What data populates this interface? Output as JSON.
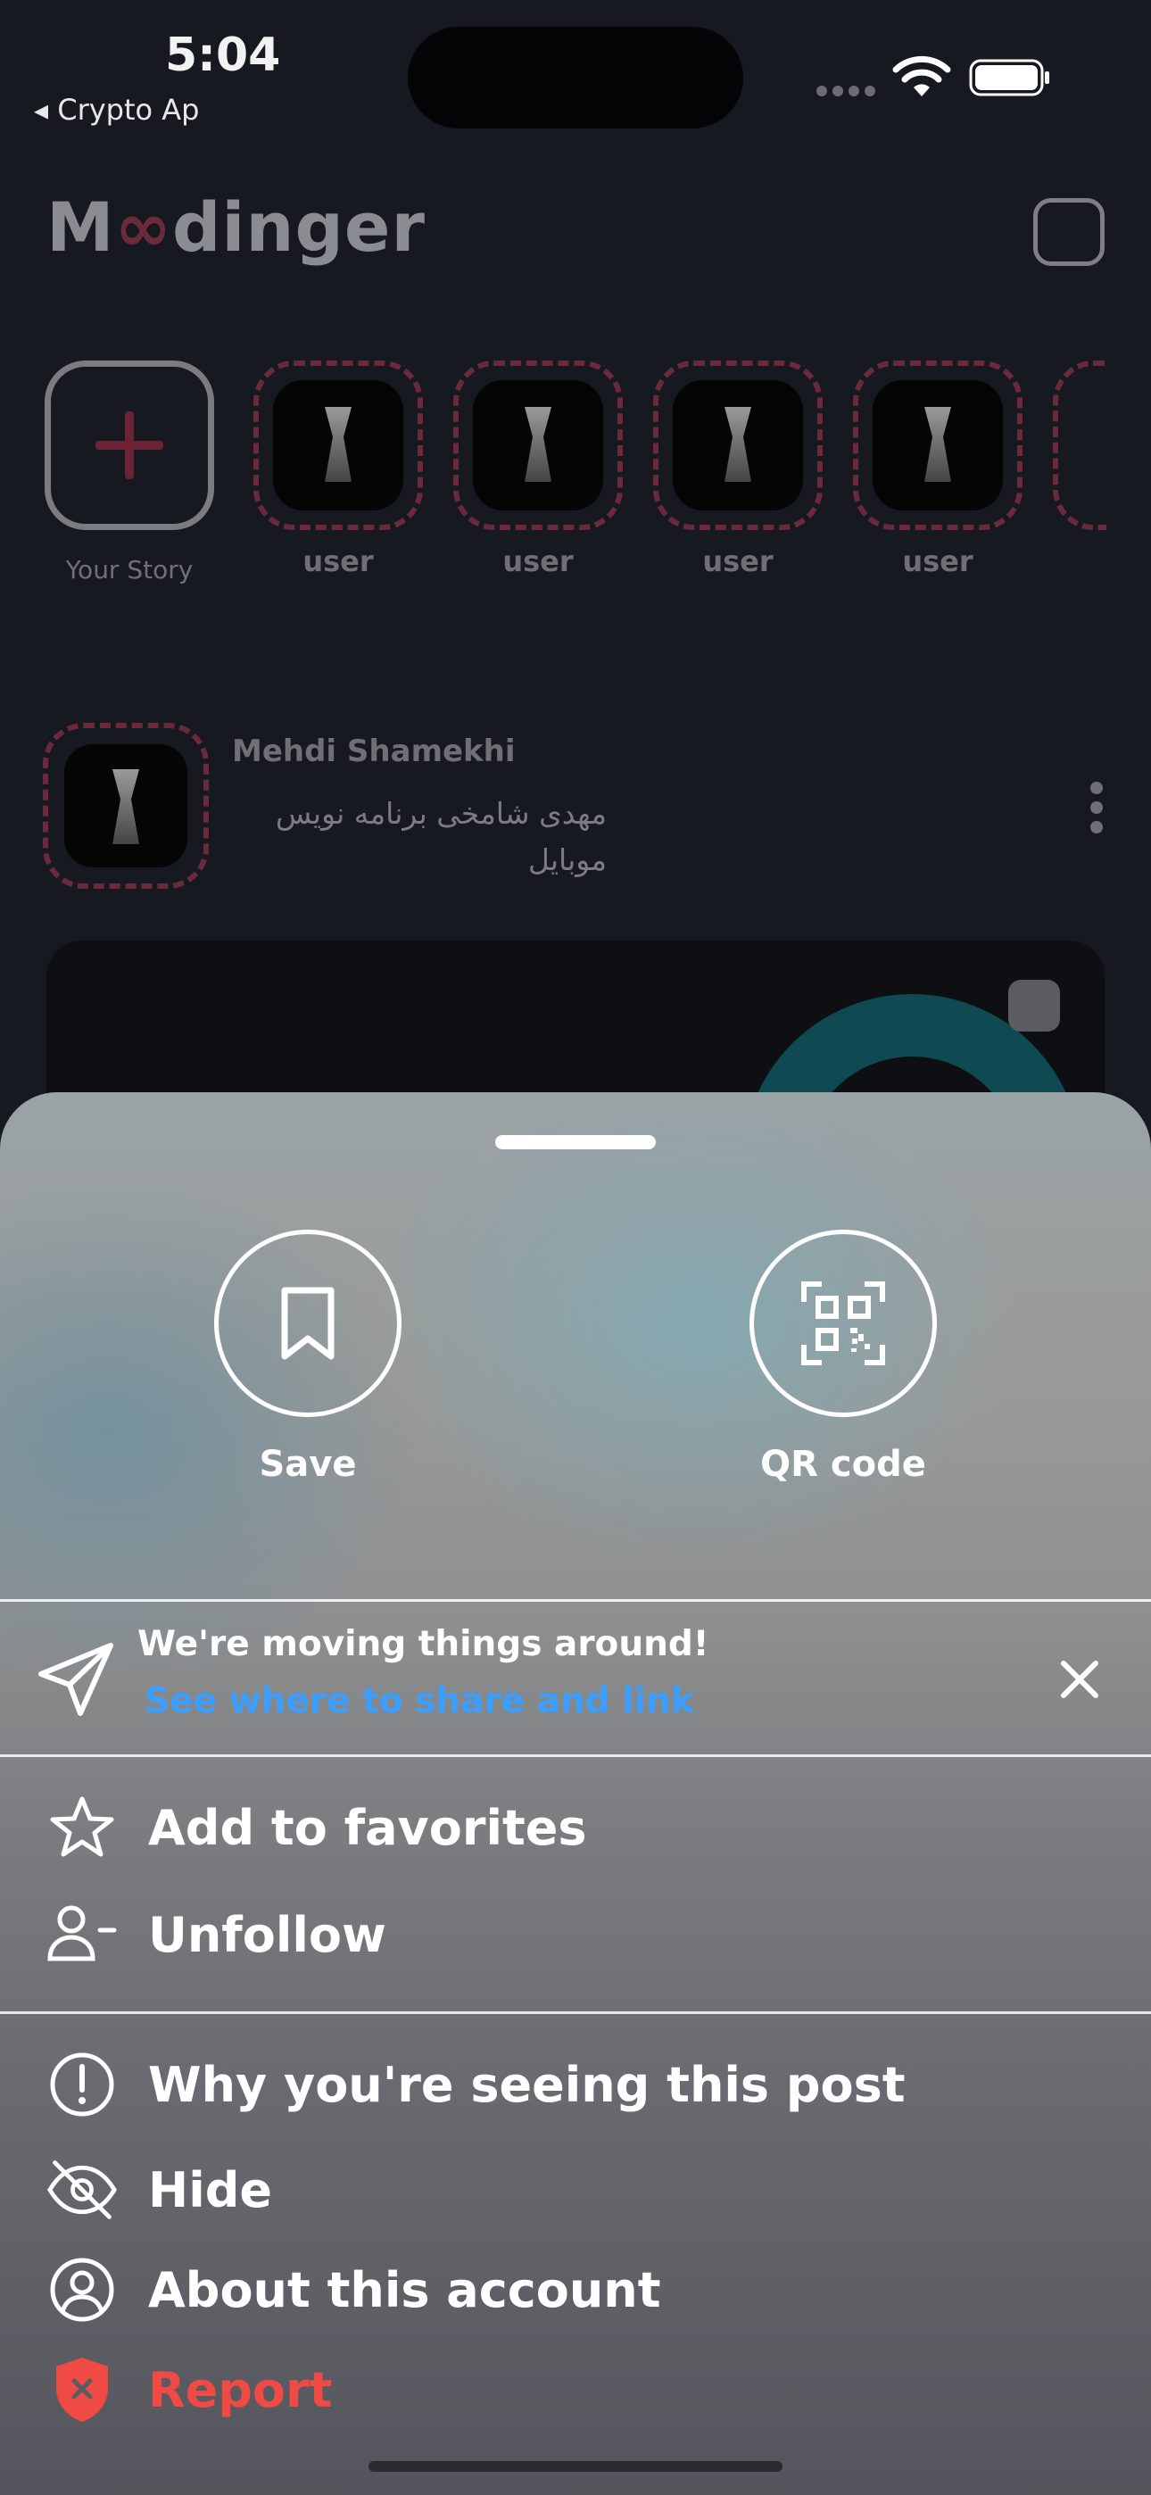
{
  "status_bar": {
    "time": "5:04",
    "back_app": "◂ Crypto Ap"
  },
  "header": {
    "logo": "Moodinger",
    "logo_parts": [
      "M",
      "∞",
      "dinger"
    ],
    "inbox_icon": "inbox-icon"
  },
  "stories": {
    "add_label": "Your Story",
    "items": [
      {
        "label": "user"
      },
      {
        "label": "user"
      },
      {
        "label": "user"
      },
      {
        "label": "user"
      }
    ]
  },
  "post": {
    "author": "Mehdi Shamekhi",
    "bio": "مهدی شامخی برنامه نویس موبایل"
  },
  "sheet": {
    "actions": [
      {
        "label": "Save",
        "icon": "bookmark-icon"
      },
      {
        "label": "QR code",
        "icon": "qr-code-icon"
      }
    ],
    "notice": {
      "title": "We're moving things around!",
      "link": "See where to share and link"
    },
    "group1": [
      {
        "label": "Add to favorites",
        "icon": "star-icon"
      },
      {
        "label": "Unfollow",
        "icon": "unfollow-icon"
      }
    ],
    "group2": [
      {
        "label": "Why you're seeing this post",
        "icon": "info-icon"
      },
      {
        "label": "Hide",
        "icon": "eye-off-icon"
      },
      {
        "label": "About this account",
        "icon": "account-icon"
      },
      {
        "label": "Report",
        "icon": "report-shield-icon"
      }
    ],
    "colors": {
      "link": "#3a9fff",
      "danger": "#f04a44"
    }
  }
}
